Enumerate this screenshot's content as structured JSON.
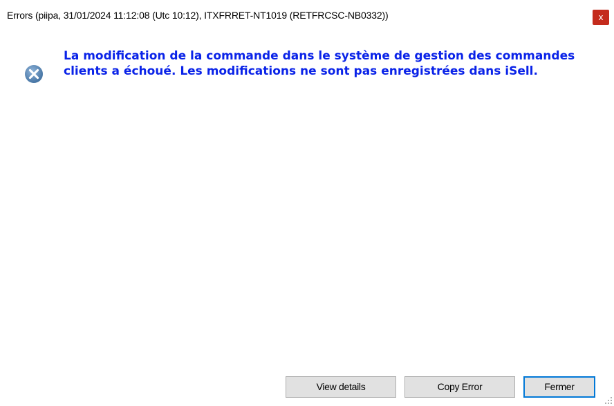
{
  "window": {
    "title": "Errors (piipa, 31/01/2024 11:12:08 (Utc 10:12), ITXFRRET-NT1019 (RETFRCSC-NB0332))",
    "close_label": "x"
  },
  "error": {
    "icon": "error-x-icon",
    "message": "La modification de la commande dans le système de gestion des commandes clients a échoué. Les modifications ne sont pas enregistrées dans iSell."
  },
  "buttons": {
    "view_details": "View details",
    "copy_error": "Copy Error",
    "close": "Fermer"
  },
  "colors": {
    "message_text": "#0a23e8",
    "close_button": "#c42b1c",
    "icon_fill": "#5f8fbf",
    "default_button_border": "#0078d7"
  }
}
